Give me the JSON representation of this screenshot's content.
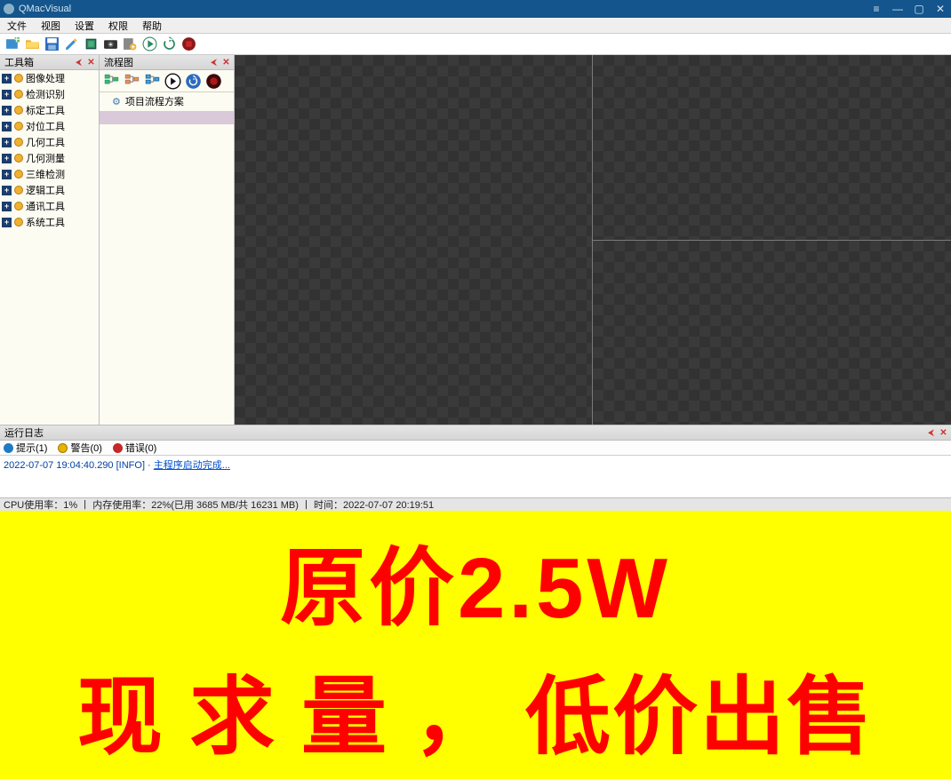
{
  "title": "QMacVisual",
  "menu": [
    "文件",
    "视图",
    "设置",
    "权限",
    "帮助"
  ],
  "toolbox": {
    "title": "工具箱",
    "items": [
      "图像处理",
      "检测识别",
      "标定工具",
      "对位工具",
      "几何工具",
      "几何测量",
      "三维检测",
      "逻辑工具",
      "通讯工具",
      "系统工具"
    ]
  },
  "flowchart": {
    "title": "流程图",
    "tree_item": "项目流程方案"
  },
  "log": {
    "title": "运行日志",
    "filters": {
      "hint": "提示(1)",
      "warn": "警告(0)",
      "err": "错误(0)"
    },
    "line_ts": "2022-07-07 19:04:40.290 [INFO]  · ",
    "line_msg": "主程序启动完成..."
  },
  "status": "CPU使用率：1%  丨 内存使用率：22%(已用 3685 MB/共 16231 MB)  丨 时间：2022-07-07 20:19:51",
  "banner": {
    "l1": "原价2.5W",
    "l2a": "现求量，",
    "l2b": "低价出售"
  }
}
